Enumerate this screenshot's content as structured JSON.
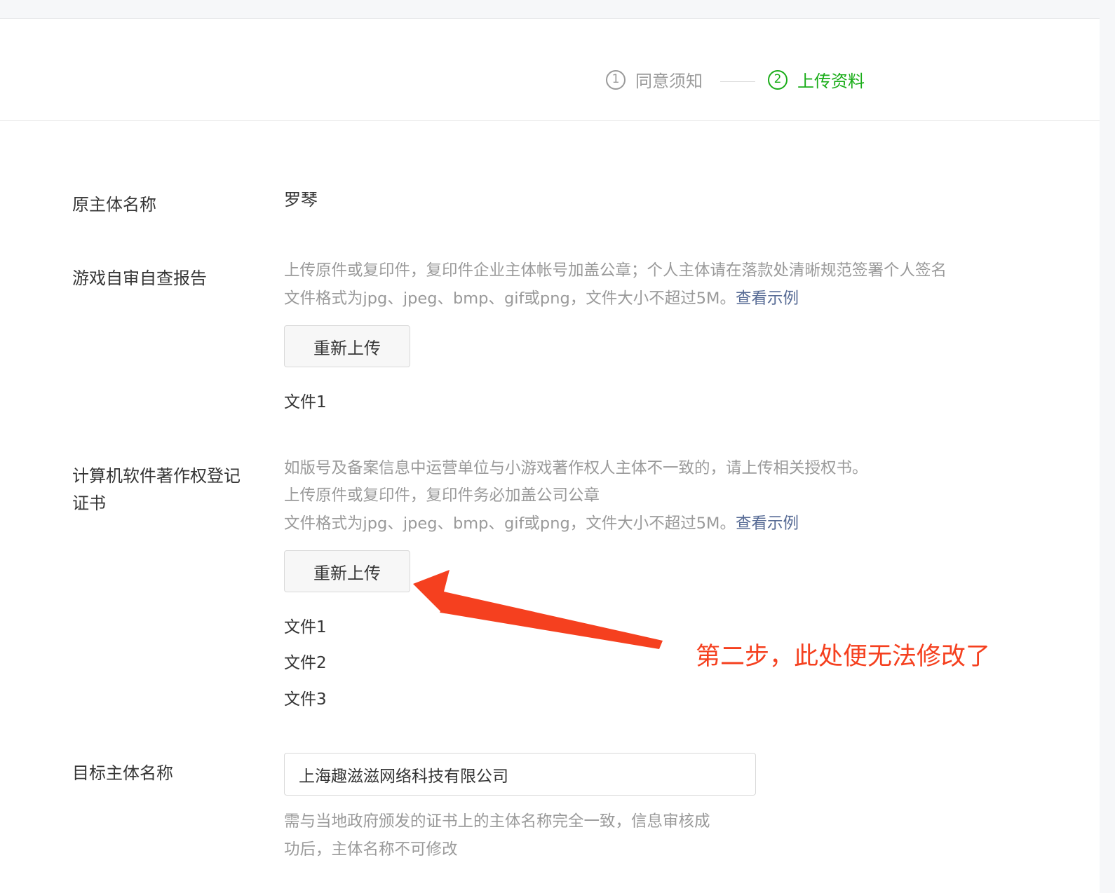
{
  "steps": [
    {
      "number": "1",
      "label": "同意须知"
    },
    {
      "number": "2",
      "label": "上传资料"
    }
  ],
  "original_entity": {
    "label": "原主体名称",
    "value": "罗琴"
  },
  "self_check_report": {
    "label": "游戏自审自查报告",
    "hint_line1": "上传原件或复印件，复印件企业主体帐号加盖公章；个人主体请在落款处清晰规范签署个人签名",
    "hint_line2": "文件格式为jpg、jpeg、bmp、gif或png，文件大小不超过5M。",
    "example_link": "查看示例",
    "reupload_button": "重新上传",
    "files": [
      "文件1"
    ]
  },
  "copyright_cert": {
    "label_line1": "计算机软件著作权登记",
    "label_line2": "证书",
    "hint_line1": "如版号及备案信息中运营单位与小游戏著作权人主体不一致的，请上传相关授权书。",
    "hint_line2": "上传原件或复印件，复印件务必加盖公司公章",
    "hint_line3": "文件格式为jpg、jpeg、bmp、gif或png，文件大小不超过5M。",
    "example_link": "查看示例",
    "reupload_button": "重新上传",
    "files": [
      "文件1",
      "文件2",
      "文件3"
    ]
  },
  "target_entity": {
    "label": "目标主体名称",
    "input_value": "上海趣滋滋网络科技有限公司",
    "hint_line1": "需与当地政府颁发的证书上的主体名称完全一致，信息审核成",
    "hint_line2": "功后，主体名称不可修改"
  },
  "annotation": {
    "text": "第二步，此处便无法修改了",
    "color": "#f5401f"
  },
  "colors": {
    "accent_green": "#1aad19",
    "link_blue": "#576b95",
    "hint_gray": "#9a9a9a"
  }
}
